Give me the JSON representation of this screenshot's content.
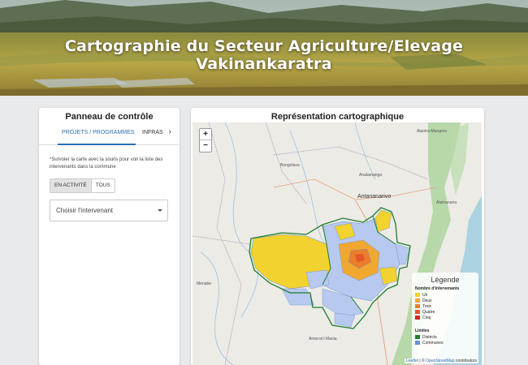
{
  "header": {
    "title": "Cartographie du Secteur Agriculture/Elevage Vakinankaratra"
  },
  "control_panel": {
    "title": "Panneau de contrôle",
    "tabs": [
      {
        "label": "PROJETS / PROGRAMMES",
        "active": true
      },
      {
        "label": "INFRAS",
        "active": false
      }
    ],
    "hint": "*Survoler la carte avec la souris pour voir la liste des intervenants dans la commune",
    "toggle": {
      "on_label": "EN ACTIVITÉ",
      "off_label": "TOUS"
    },
    "select": {
      "placeholder": "Choisir l'intervenant"
    }
  },
  "map_panel": {
    "title": "Représentation cartographique",
    "zoom_in": "+",
    "zoom_out": "−",
    "labels": {
      "antananarivo": "Antananarivo",
      "bongolava": "Bongolava",
      "itasy": "Analamanga",
      "alaotra": "Alaotra-Mangoro",
      "atsinanana": "Atsinanana",
      "menabe": "Menabe",
      "amoron": "Amoron'i Mania"
    },
    "legend": {
      "title": "Légende",
      "count_heading": "Nombre d'intervenants",
      "count_items": [
        {
          "label": "Un",
          "color": "#f2d22e"
        },
        {
          "label": "Deux",
          "color": "#f0a830"
        },
        {
          "label": "Trois",
          "color": "#ec7d2a"
        },
        {
          "label": "Quatre",
          "color": "#e5562a"
        },
        {
          "label": "Cinq",
          "color": "#d42626"
        }
      ],
      "limits_heading": "Limites",
      "limit_items": [
        {
          "label": "Districts",
          "color": "#1e7d2e"
        },
        {
          "label": "Communes",
          "color": "#6a8fd6"
        }
      ]
    },
    "attribution": {
      "leaflet": "Leaflet",
      "sep": " | © ",
      "osm": "OpenStreetMap",
      "suffix": " contributors"
    }
  }
}
